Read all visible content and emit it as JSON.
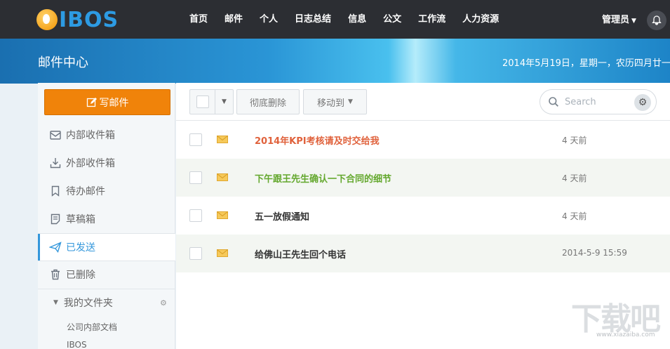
{
  "app": {
    "logo_text": "IBOS"
  },
  "nav": {
    "items": [
      "首页",
      "邮件",
      "个人",
      "日志总结",
      "信息",
      "公文",
      "工作流",
      "人力资源"
    ],
    "user": "管理员"
  },
  "banner": {
    "title": "邮件中心",
    "date": "2014年5月19日，星期一，农历四月廿一"
  },
  "sidebar": {
    "compose_label": "写邮件",
    "items": [
      {
        "label": "内部收件箱",
        "icon": "inbox-icon"
      },
      {
        "label": "外部收件箱",
        "icon": "download-icon"
      },
      {
        "label": "待办邮件",
        "icon": "bookmark-icon"
      },
      {
        "label": "草稿箱",
        "icon": "draft-icon"
      },
      {
        "label": "已发送",
        "icon": "send-icon",
        "active": true
      },
      {
        "label": "已删除",
        "icon": "trash-icon"
      }
    ],
    "folder_title": "我的文件夹",
    "folders": [
      "公司内部文档",
      "IBOS"
    ]
  },
  "toolbar": {
    "delete_label": "彻底删除",
    "move_label": "移动到",
    "search_placeholder": "Search"
  },
  "emails": [
    {
      "subject": "2014年KPI考核请及时交给我",
      "time": "4 天前",
      "color": "#e0623c"
    },
    {
      "subject": "下午跟王先生确认一下合同的细节",
      "time": "4 天前",
      "color": "#64a82e"
    },
    {
      "subject": "五一放假通知",
      "time": "4 天前",
      "color": "#333333"
    },
    {
      "subject": "给佛山王先生回个电话",
      "time": "2014-5-9 15:59",
      "color": "#333333"
    }
  ],
  "watermark": {
    "big": "下载吧",
    "small": "www.xiazaiba.com"
  },
  "colors": {
    "accent_orange": "#f0830a",
    "active_blue": "#3497db",
    "topbar": "#2c2e33"
  }
}
